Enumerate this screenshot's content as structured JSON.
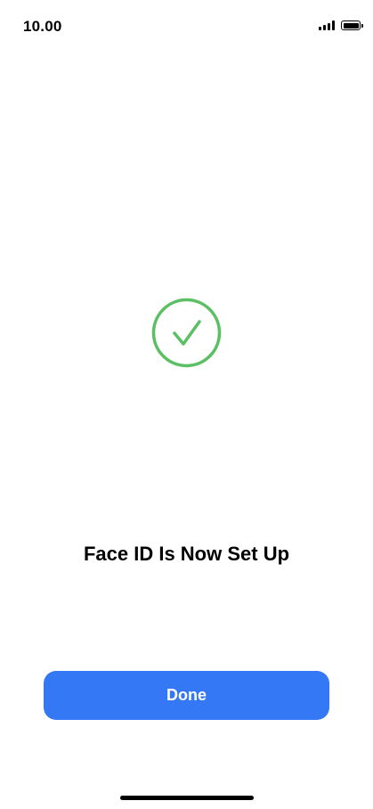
{
  "status_bar": {
    "time": "10.00",
    "signal_icon": "cellular-signal-icon",
    "battery_icon": "battery-full-icon"
  },
  "main": {
    "icon": "checkmark-circle-icon",
    "title": "Face ID Is Now Set Up",
    "done_label": "Done"
  },
  "colors": {
    "accent": "#3478f6",
    "success": "#5bbf63"
  }
}
